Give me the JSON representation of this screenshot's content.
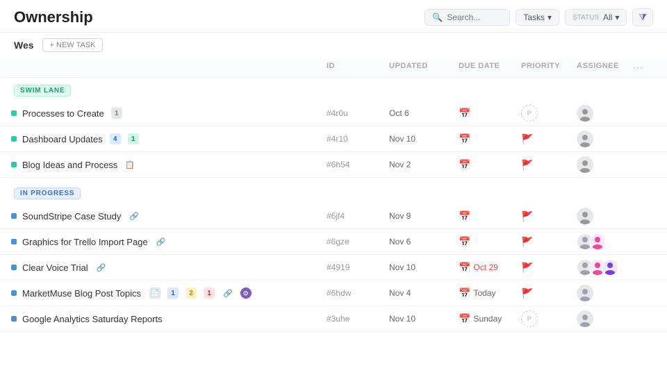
{
  "header": {
    "title": "Ownership",
    "search_placeholder": "Search...",
    "tasks_label": "Tasks",
    "status_label": "STATUS",
    "status_value": "All",
    "filter_icon": "funnel-icon"
  },
  "sub_header": {
    "user": "Wes",
    "new_task_label": "+ NEW TASK"
  },
  "table": {
    "columns": [
      "ID",
      "UPDATED",
      "DUE DATE",
      "PRIORITY",
      "ASSIGNEE",
      ""
    ]
  },
  "sections": [
    {
      "id": "swim-lane",
      "label": "SWIM LANE",
      "type": "swim_lane",
      "tasks": [
        {
          "name": "Processes to Create",
          "badge": "1",
          "badge_type": "gray",
          "id": "#4r0u",
          "updated": "Oct 6",
          "due_date": "—",
          "due_overdue": false,
          "due_today": false,
          "priority": "placeholder",
          "dot": "green"
        },
        {
          "name": "Dashboard Updates",
          "badge": "4",
          "badge_type": "blue",
          "badge2": "1",
          "badge2_type": "badge-teal",
          "id": "#4r10",
          "updated": "Nov 10",
          "due_date": "—",
          "due_overdue": false,
          "due_today": false,
          "priority": "red",
          "dot": "green"
        },
        {
          "name": "Blog Ideas and Process",
          "badge": null,
          "badge_type": null,
          "id": "#6h54",
          "updated": "Nov 2",
          "due_date": "—",
          "due_overdue": false,
          "due_today": false,
          "priority": "red",
          "dot": "green",
          "has_emoji": true,
          "emoji": "📋"
        }
      ]
    },
    {
      "id": "in-progress",
      "label": "IN PROGRESS",
      "type": "in_progress",
      "tasks": [
        {
          "name": "SoundStripe Case Study",
          "badge": null,
          "id": "#6jf4",
          "updated": "Nov 9",
          "due_date": "—",
          "due_overdue": false,
          "due_today": false,
          "priority": "yellow",
          "dot": "blue",
          "has_link": true
        },
        {
          "name": "Graphics for Trello Import Page",
          "badge": null,
          "id": "#6gze",
          "updated": "Nov 6",
          "due_date": "—",
          "due_overdue": false,
          "due_today": false,
          "priority": "yellow",
          "dot": "blue",
          "has_link": true,
          "multi_assignee": true
        },
        {
          "name": "Clear Voice Trial",
          "badge": null,
          "id": "#4919",
          "updated": "Nov 10",
          "due_date": "Oct 29",
          "due_overdue": true,
          "due_today": false,
          "priority": "teal",
          "dot": "blue",
          "has_link": true,
          "multi_assignee": true,
          "three_avatars": true
        },
        {
          "name": "MarketMuse Blog Post Topics",
          "badges_multi": true,
          "id": "#6hdw",
          "updated": "Nov 4",
          "due_date": "Today",
          "due_overdue": false,
          "due_today": true,
          "priority": "yellow",
          "dot": "blue",
          "has_link": true,
          "has_spinner": true
        },
        {
          "name": "Google Analytics Saturday Reports",
          "badge": null,
          "id": "#3uhe",
          "updated": "Nov 10",
          "due_date": "Sunday",
          "due_overdue": false,
          "due_today": false,
          "priority": "placeholder",
          "dot": "blue"
        }
      ]
    }
  ]
}
